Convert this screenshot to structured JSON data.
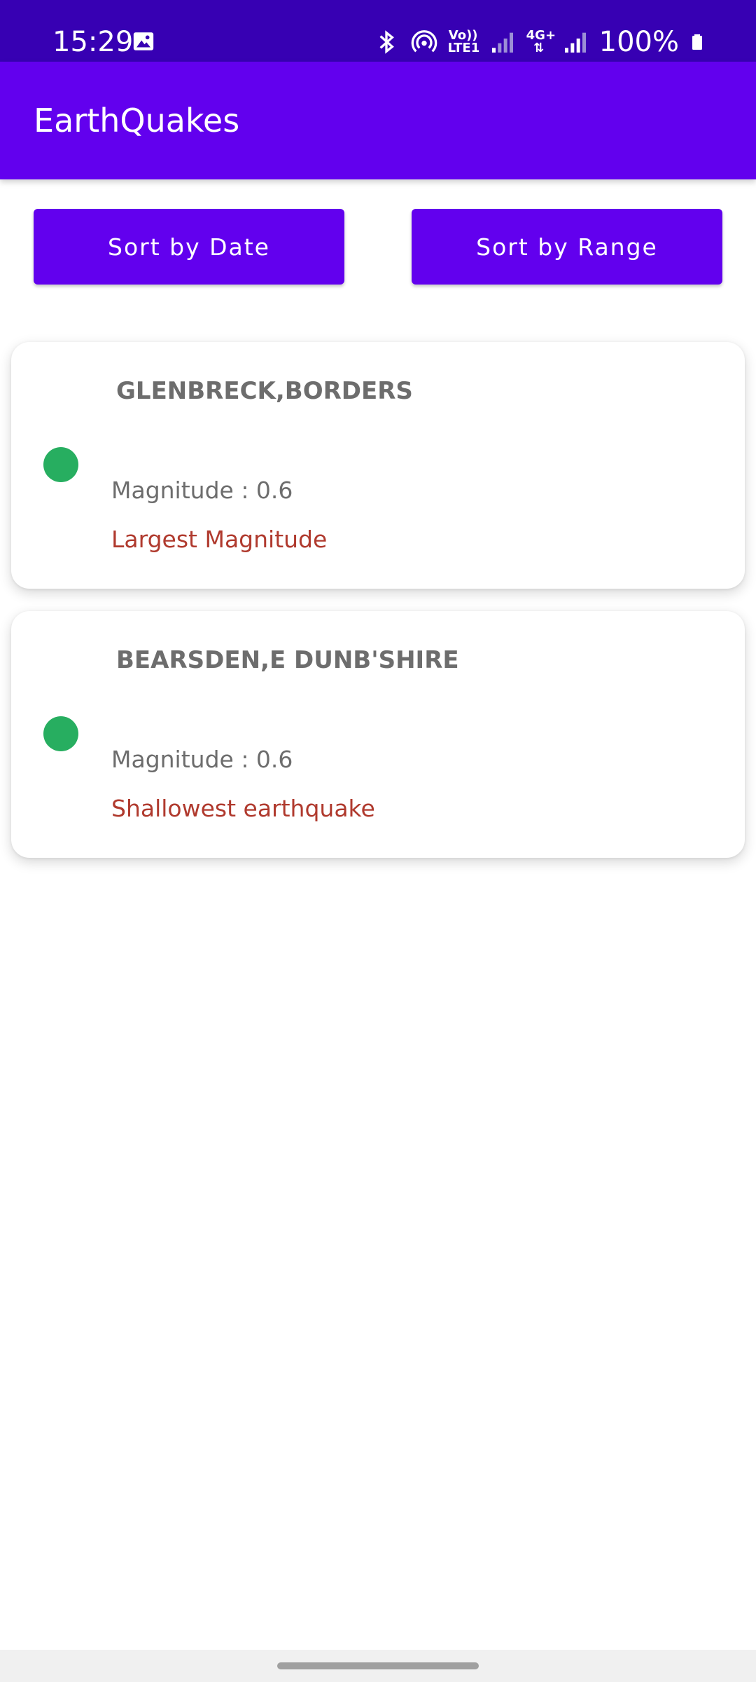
{
  "status_bar": {
    "time": "15:29",
    "battery": "100%",
    "icons": [
      "photo-icon",
      "bluetooth-icon",
      "hotspot-icon",
      "volte-icon",
      "signal-icon",
      "4g-data-icon",
      "signal-icon",
      "battery-icon"
    ],
    "volte_top": "Vo))",
    "volte_bottom": "LTE1",
    "data_label": "4G+"
  },
  "app_bar": {
    "title": "EarthQuakes"
  },
  "sort": {
    "date_label": "Sort by Date",
    "range_label": "Sort by Range"
  },
  "quakes": [
    {
      "location": "GLENBRECK,BORDERS",
      "magnitude": "Magnitude : 0.6",
      "note": "Largest Magnitude"
    },
    {
      "location": "BEARSDEN,E DUNB'SHIRE",
      "magnitude": "Magnitude : 0.6",
      "note": "Shallowest earthquake"
    }
  ],
  "colors": {
    "primary": "#6200ee",
    "status_bar": "#3700b3",
    "magnitude_dot": "#27ae60",
    "note_text": "#b03a2e"
  }
}
